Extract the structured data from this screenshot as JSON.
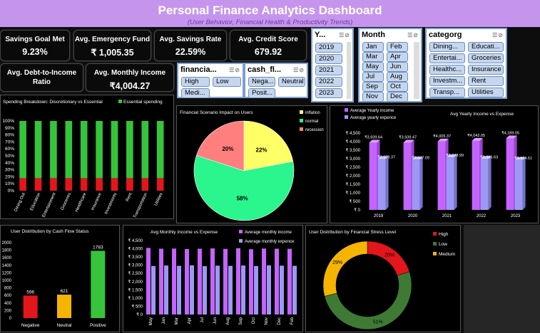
{
  "header": {
    "title": "Personal Finance Analytics Dashboard",
    "subtitle": "(User Behavior, Financial Health & Productivity Trends)"
  },
  "kpis": [
    {
      "label": "Savings Goal Met",
      "value": "9.23%"
    },
    {
      "label": "Avg. Emergency Fund",
      "value": "₹ 1,005.35"
    },
    {
      "label": "Avg. Savings Rate",
      "value": "22.59%"
    },
    {
      "label": "Avg. Credit Score",
      "value": "679.92"
    },
    {
      "label": "Avg. Debt-to-Income Ratio",
      "value": ""
    },
    {
      "label": "Avg. Monthly Income",
      "value": "₹4,004.27"
    }
  ],
  "slicers": {
    "financial": {
      "title": "financia...",
      "items": [
        "High",
        "Low",
        "Medi..."
      ]
    },
    "cash_flow": {
      "title": "cash_fl...",
      "items": [
        "Nega...",
        "Neutral",
        "Posit..."
      ]
    },
    "year": {
      "title": "Y...",
      "items": [
        "2019",
        "2020",
        "2021",
        "2022",
        "2023"
      ]
    },
    "month": {
      "title": "Month",
      "items": [
        "Jan",
        "Feb",
        "Mar",
        "Apr",
        "May",
        "Jun",
        "Jul",
        "Aug",
        "Sep",
        "Oct",
        "Nov",
        "Dec"
      ]
    },
    "category": {
      "title": "categorg",
      "items": [
        "Dining...",
        "Educati...",
        "Entertai...",
        "Groceries",
        "Healthc...",
        "Insurance",
        "Investm...",
        "Rent",
        "Transp...",
        "Utilities"
      ]
    }
  },
  "colors": {
    "title_bg": "#c595ee",
    "green": "#35c43a",
    "red": "#e3161b",
    "purple": "#c463ff",
    "lavender": "#9d98f5",
    "yellow": "#ffff66",
    "teal": "#2bf58d",
    "salmon": "#ff7f7f",
    "orange": "#f5b400",
    "olive": "#3f7a35"
  },
  "chart_data": [
    {
      "id": "spending",
      "type": "bar",
      "title": "Spending Breakdown: Discretionary vs Essential",
      "categories": [
        "Dining Out",
        "Education",
        "Entertainment",
        "Groceries",
        "Healthcare",
        "Insurance",
        "Investments",
        "Rent",
        "Transportation",
        "Utilities"
      ],
      "series": [
        {
          "name": "Essential spending",
          "values": [
            82,
            82,
            82,
            82,
            82,
            82,
            82,
            82,
            82,
            82
          ]
        },
        {
          "name": "",
          "values": [
            18,
            18,
            18,
            18,
            18,
            18,
            18,
            18,
            18,
            18
          ]
        }
      ],
      "yticks": [
        "0%",
        "10%",
        "20%",
        "30%",
        "40%",
        "50%",
        "60%",
        "70%",
        "80%",
        "90%",
        "100%"
      ],
      "ylim": [
        0,
        100
      ]
    },
    {
      "id": "scenario",
      "type": "pie",
      "title": "Financial Scenario Impact on Users",
      "labels": [
        "inflation",
        "normal",
        "recession"
      ],
      "values": [
        22,
        58,
        20
      ],
      "value_labels": [
        "22%",
        "58%",
        "20%"
      ]
    },
    {
      "id": "yearly",
      "type": "bar",
      "title": "Avg Yearly Income vs Expense",
      "categories": [
        "2019",
        "2020",
        "2021",
        "2022",
        "2023"
      ],
      "series": [
        {
          "name": "Average Yearly income",
          "values": [
            3939.64,
            3939.47,
            4005.37,
            4042.05,
            4189.05
          ],
          "labels": [
            "₹3,939.64",
            "₹3,939.47",
            "₹4,005.37",
            "₹4,042.05",
            "₹4,189.05"
          ]
        },
        {
          "name": "Average yearly expence",
          "values": [
            2979.37,
            2947.09,
            3078.99,
            2986.63,
            2924.51
          ],
          "labels": [
            "₹2,979.37",
            "₹2,947.09",
            "₹3,078.99",
            "₹2,986.63",
            "₹2,924.51"
          ]
        }
      ],
      "yticks": [
        "₹ 0",
        "₹ 500",
        "₹ 1,000",
        "₹ 1,500",
        "₹ 2,000",
        "₹ 2,500",
        "₹ 3,000",
        "₹ 3,500",
        "₹ 4,000",
        "₹ 4,500"
      ],
      "ylim": [
        0,
        4500
      ]
    },
    {
      "id": "cashflow",
      "type": "bar",
      "title": "User Distribution by Cash Flow Status",
      "categories": [
        "Negative",
        "Neutral",
        "Positive"
      ],
      "values": [
        596,
        621,
        1783
      ],
      "yticks": [
        "0",
        "200",
        "400",
        "600",
        "800",
        "1000",
        "1200",
        "1400",
        "1600",
        "1800",
        "2000"
      ],
      "ylim": [
        0,
        2000
      ]
    },
    {
      "id": "monthly",
      "type": "bar",
      "title": "Avg Monthly Income vs Expense",
      "categories": [
        "May",
        "Jan",
        "Mar",
        "Apr",
        "Jul",
        "Jun",
        "Aug",
        "Sep",
        "Oct",
        "Nov",
        "Dec",
        "Feb"
      ],
      "series": [
        {
          "name": "Average monthly income",
          "values": [
            4050,
            4000,
            4010,
            3980,
            4000,
            4020,
            3990,
            4030,
            3970,
            4010,
            4000,
            3995
          ]
        },
        {
          "name": "Average monthly expence",
          "values": [
            2950,
            2980,
            2960,
            2990,
            2940,
            2970,
            2960,
            2980,
            2950,
            2990,
            2970,
            2960
          ]
        }
      ],
      "yticks": [
        "₹ 0",
        "₹ 500",
        "₹ 1,000",
        "₹ 1,500",
        "₹ 2,000",
        "₹ 2,500",
        "₹ 3,000",
        "₹ 3,500",
        "₹ 4,000",
        "₹ 4,500"
      ],
      "ylim": [
        0,
        4500
      ]
    },
    {
      "id": "stress",
      "type": "pie",
      "title": "User Distribution by Financial Stress Level",
      "labels": [
        "High",
        "Low",
        "Medium"
      ],
      "values": [
        20,
        51,
        29
      ],
      "value_labels": [
        "20%",
        "51%",
        "29%"
      ]
    }
  ]
}
